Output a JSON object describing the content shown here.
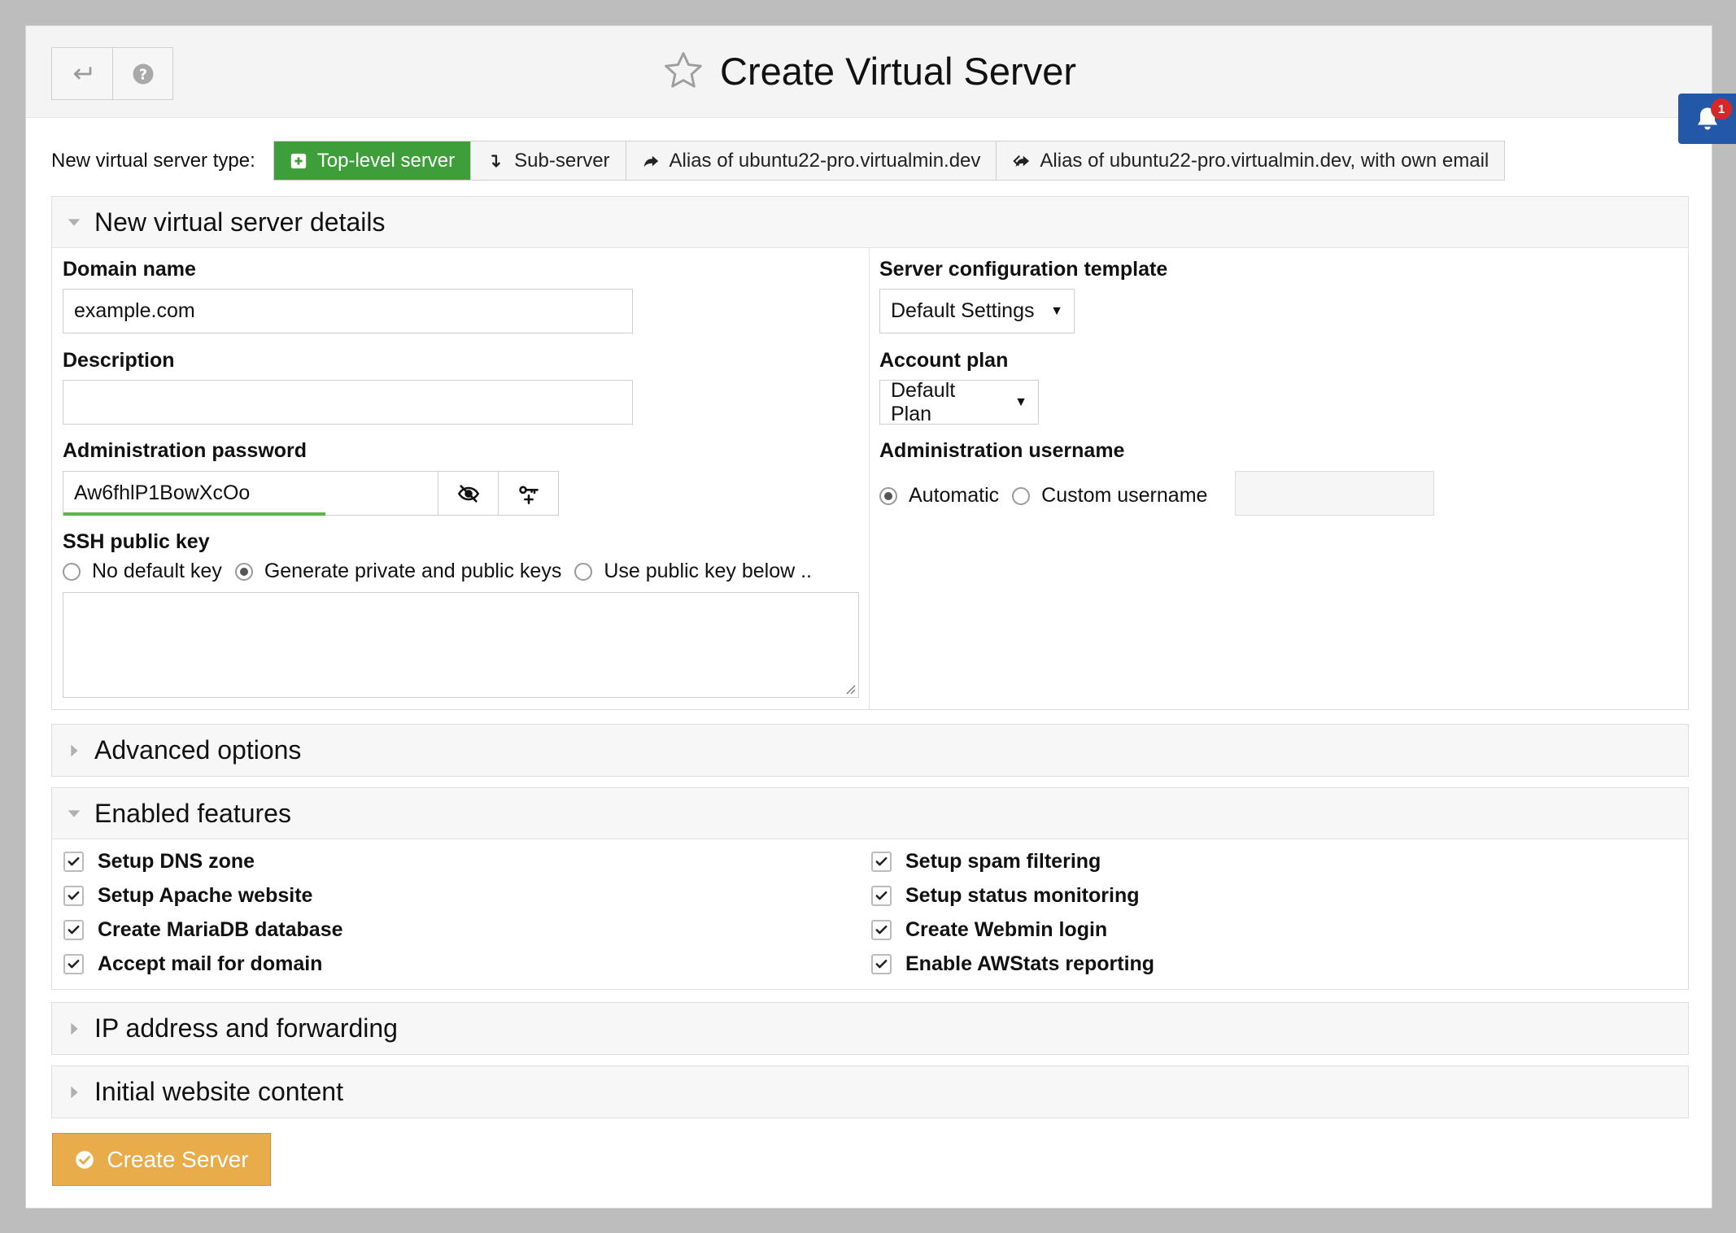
{
  "header": {
    "title": "Create Virtual Server",
    "back_icon": "return-arrow-icon",
    "help_icon": "help-circle-icon",
    "favorite_icon": "star-outline-icon"
  },
  "notifications": {
    "count": "1",
    "icon": "bell-icon",
    "color": "#2358a8"
  },
  "server_type": {
    "label": "New virtual server type:",
    "options": [
      {
        "label": "Top-level server",
        "icon": "plus-square-icon",
        "selected": true
      },
      {
        "label": "Sub-server",
        "icon": "level-down-icon",
        "selected": false
      },
      {
        "label": "Alias of ubuntu22-pro.virtualmin.dev",
        "icon": "share-arrow-icon",
        "selected": false
      },
      {
        "label": "Alias of ubuntu22-pro.virtualmin.dev, with own email",
        "icon": "share-all-icon",
        "selected": false
      }
    ],
    "active_color": "#3e9f3a"
  },
  "details": {
    "title": "New virtual server details",
    "domain_label": "Domain name",
    "domain_value": "example.com",
    "description_label": "Description",
    "description_value": "",
    "password_label": "Administration password",
    "password_value": "Aw6fhlP1BowXcOo",
    "password_strength": 0.77,
    "ssh_label": "SSH public key",
    "ssh_options": [
      {
        "label": "No default key",
        "selected": false
      },
      {
        "label": "Generate private and public keys",
        "selected": true
      },
      {
        "label": "Use public key below ..",
        "selected": false
      }
    ],
    "ssh_key_value": "",
    "template_label": "Server configuration template",
    "template_value": "Default Settings",
    "plan_label": "Account plan",
    "plan_value": "Default Plan",
    "username_label": "Administration username",
    "username_options": [
      {
        "label": "Automatic",
        "selected": true
      },
      {
        "label": "Custom username",
        "selected": false
      }
    ],
    "username_value": ""
  },
  "advanced": {
    "title": "Advanced options"
  },
  "features": {
    "title": "Enabled features",
    "left": [
      {
        "label": "Setup DNS zone",
        "checked": true
      },
      {
        "label": "Setup Apache website",
        "checked": true
      },
      {
        "label": "Create MariaDB database",
        "checked": true
      },
      {
        "label": "Accept mail for domain",
        "checked": true
      }
    ],
    "right": [
      {
        "label": "Setup spam filtering",
        "checked": true
      },
      {
        "label": "Setup status monitoring",
        "checked": true
      },
      {
        "label": "Create Webmin login",
        "checked": true
      },
      {
        "label": "Enable AWStats reporting",
        "checked": true
      }
    ]
  },
  "ip_section": {
    "title": "IP address and forwarding"
  },
  "website_section": {
    "title": "Initial website content"
  },
  "submit": {
    "label": "Create Server",
    "color": "#e8ad4a"
  }
}
